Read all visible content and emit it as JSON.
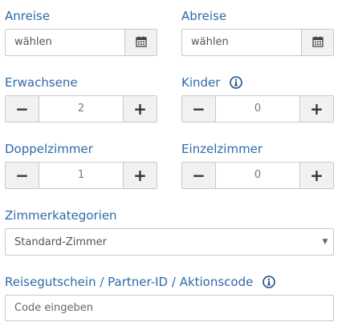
{
  "arrival": {
    "label": "Anreise",
    "value": "wählen"
  },
  "departure": {
    "label": "Abreise",
    "value": "wählen"
  },
  "adults": {
    "label": "Erwachsene",
    "value": "2"
  },
  "children": {
    "label": "Kinder",
    "value": "0"
  },
  "double_rooms": {
    "label": "Doppelzimmer",
    "value": "1"
  },
  "single_rooms": {
    "label": "Einzelzimmer",
    "value": "0"
  },
  "room_category": {
    "label": "Zimmerkategorien",
    "selected": "Standard-Zimmer"
  },
  "voucher": {
    "label": "Reisegutschein / Partner-ID / Aktionscode",
    "placeholder": "Code eingeben"
  },
  "stepper": {
    "minus": "−",
    "plus": "+"
  },
  "select_caret": "▼",
  "icons": {
    "calendar": "calendar-icon",
    "info": "info-icon"
  },
  "colors": {
    "label": "#2d6aa8",
    "button_bg": "#f1f1f1",
    "border": "#c9c9c9"
  }
}
